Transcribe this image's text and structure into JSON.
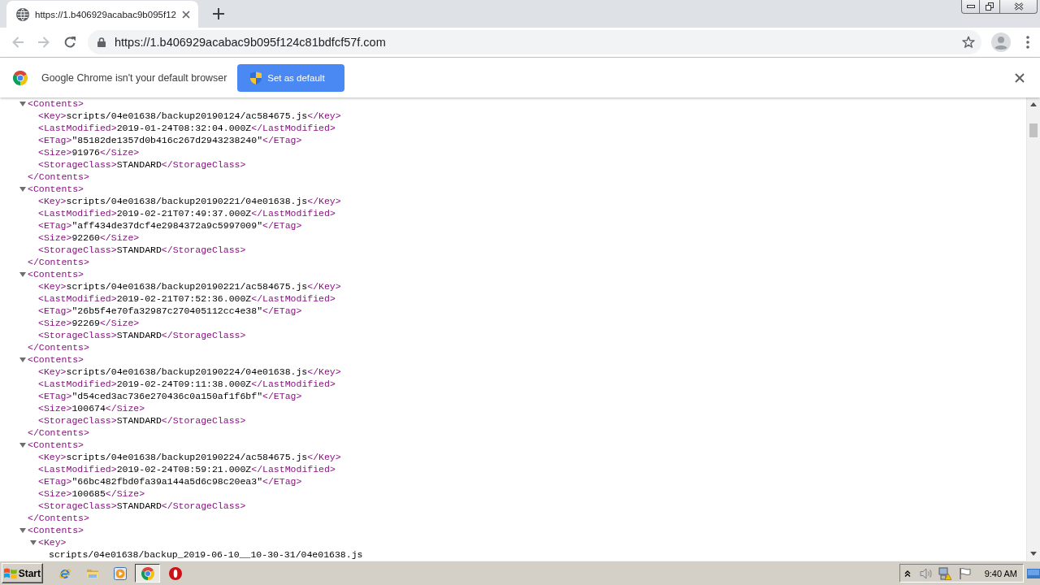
{
  "tabs": [
    {
      "title": "https://1.b406929acabac9b095f12",
      "selected": true
    }
  ],
  "toolbar": {
    "nav_buttons": [
      {
        "kind": "back",
        "disabled": true
      },
      {
        "kind": "forward",
        "disabled": true
      },
      {
        "kind": "reload",
        "disabled": false
      }
    ],
    "url": "https://1.b406929acabac9b095f124c81bdfcf57f.com"
  },
  "infobar": {
    "message": "Google Chrome isn't your default browser",
    "button": "Set as default"
  },
  "xml_tree": [
    {
      "kind": "block",
      "expanded": true,
      "open": "<Contents>",
      "children": [
        {
          "kind": "inline",
          "open": "<Key>",
          "value": "scripts/04e01638/backup20190124/ac584675.js",
          "close": "</Key>"
        },
        {
          "kind": "inline",
          "open": "<LastModified>",
          "value": "2019-01-24T08:32:04.000Z",
          "close": "</LastModified>"
        },
        {
          "kind": "inline",
          "open": "<ETag>",
          "value": "\"85182de1357d0b416c267d2943238240\"",
          "close": "</ETag>"
        },
        {
          "kind": "inline",
          "open": "<Size>",
          "value": "91976",
          "close": "</Size>"
        },
        {
          "kind": "inline",
          "open": "<StorageClass>",
          "value": "STANDARD",
          "close": "</StorageClass>"
        }
      ],
      "close": "</Contents>"
    },
    {
      "kind": "block",
      "expanded": true,
      "open": "<Contents>",
      "children": [
        {
          "kind": "inline",
          "open": "<Key>",
          "value": "scripts/04e01638/backup20190221/04e01638.js",
          "close": "</Key>"
        },
        {
          "kind": "inline",
          "open": "<LastModified>",
          "value": "2019-02-21T07:49:37.000Z",
          "close": "</LastModified>"
        },
        {
          "kind": "inline",
          "open": "<ETag>",
          "value": "\"aff434de37dcf4e2984372a9c5997009\"",
          "close": "</ETag>"
        },
        {
          "kind": "inline",
          "open": "<Size>",
          "value": "92260",
          "close": "</Size>"
        },
        {
          "kind": "inline",
          "open": "<StorageClass>",
          "value": "STANDARD",
          "close": "</StorageClass>"
        }
      ],
      "close": "</Contents>"
    },
    {
      "kind": "block",
      "expanded": true,
      "open": "<Contents>",
      "children": [
        {
          "kind": "inline",
          "open": "<Key>",
          "value": "scripts/04e01638/backup20190221/ac584675.js",
          "close": "</Key>"
        },
        {
          "kind": "inline",
          "open": "<LastModified>",
          "value": "2019-02-21T07:52:36.000Z",
          "close": "</LastModified>"
        },
        {
          "kind": "inline",
          "open": "<ETag>",
          "value": "\"26b5f4e70fa32987c270405112cc4e38\"",
          "close": "</ETag>"
        },
        {
          "kind": "inline",
          "open": "<Size>",
          "value": "92269",
          "close": "</Size>"
        },
        {
          "kind": "inline",
          "open": "<StorageClass>",
          "value": "STANDARD",
          "close": "</StorageClass>"
        }
      ],
      "close": "</Contents>"
    },
    {
      "kind": "block",
      "expanded": true,
      "open": "<Contents>",
      "children": [
        {
          "kind": "inline",
          "open": "<Key>",
          "value": "scripts/04e01638/backup20190224/04e01638.js",
          "close": "</Key>"
        },
        {
          "kind": "inline",
          "open": "<LastModified>",
          "value": "2019-02-24T09:11:38.000Z",
          "close": "</LastModified>"
        },
        {
          "kind": "inline",
          "open": "<ETag>",
          "value": "\"d54ced3ac736e270436c0a150af1f6bf\"",
          "close": "</ETag>"
        },
        {
          "kind": "inline",
          "open": "<Size>",
          "value": "100674",
          "close": "</Size>"
        },
        {
          "kind": "inline",
          "open": "<StorageClass>",
          "value": "STANDARD",
          "close": "</StorageClass>"
        }
      ],
      "close": "</Contents>"
    },
    {
      "kind": "block",
      "expanded": true,
      "open": "<Contents>",
      "children": [
        {
          "kind": "inline",
          "open": "<Key>",
          "value": "scripts/04e01638/backup20190224/ac584675.js",
          "close": "</Key>"
        },
        {
          "kind": "inline",
          "open": "<LastModified>",
          "value": "2019-02-24T08:59:21.000Z",
          "close": "</LastModified>"
        },
        {
          "kind": "inline",
          "open": "<ETag>",
          "value": "\"66bc482fbd0fa39a144a5d6c98c20ea3\"",
          "close": "</ETag>"
        },
        {
          "kind": "inline",
          "open": "<Size>",
          "value": "100685",
          "close": "</Size>"
        },
        {
          "kind": "inline",
          "open": "<StorageClass>",
          "value": "STANDARD",
          "close": "</StorageClass>"
        }
      ],
      "close": "</Contents>"
    },
    {
      "kind": "block",
      "expanded": true,
      "open": "<Contents>",
      "children": [
        {
          "kind": "block",
          "expanded": true,
          "open": "<Key>",
          "children": [
            {
              "kind": "text",
              "value": "scripts/04e01638/backup_2019-06-10__10-30-31/04e01638.js"
            }
          ]
        }
      ]
    }
  ],
  "taskbar": {
    "start": "Start",
    "apps": [
      {
        "kind": "e",
        "selected": false
      },
      {
        "kind": "folder",
        "selected": false
      },
      {
        "kind": "media",
        "selected": false
      },
      {
        "kind": "chrome",
        "selected": true
      },
      {
        "kind": "o",
        "selected": false
      }
    ],
    "clock": "9:40 AM"
  }
}
